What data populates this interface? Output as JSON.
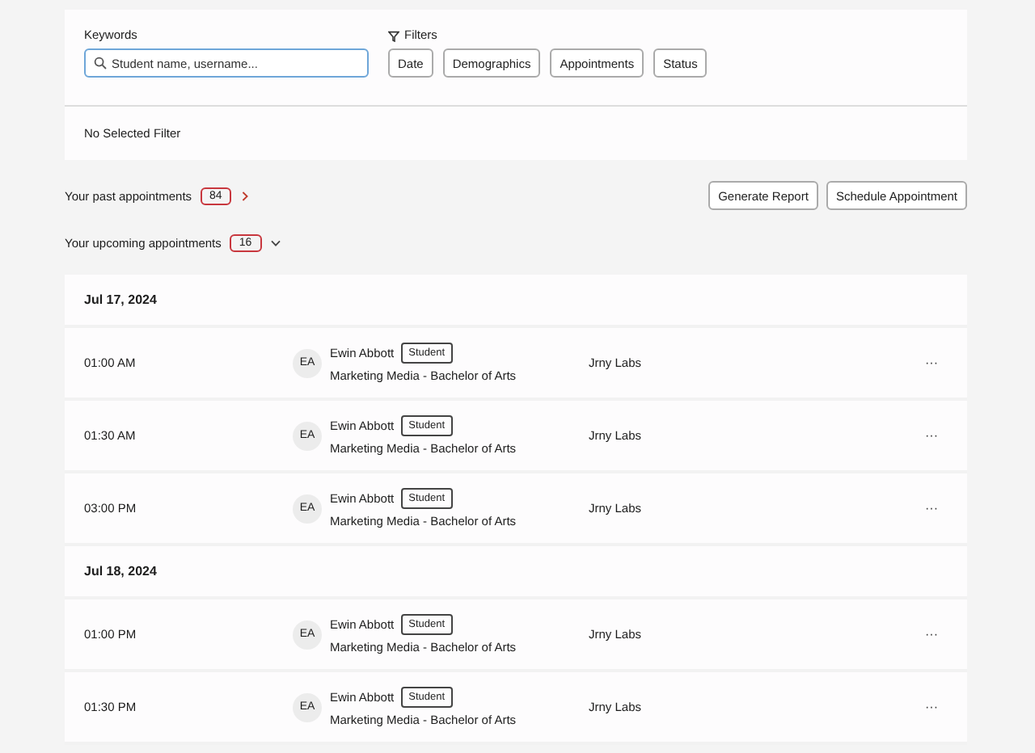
{
  "search": {
    "label": "Keywords",
    "placeholder": "Student name, username..."
  },
  "filters": {
    "label": "Filters",
    "buttons": [
      "Date",
      "Demographics",
      "Appointments",
      "Status"
    ],
    "selection": "No Selected Filter"
  },
  "past": {
    "label": "Your past appointments",
    "count": "84",
    "expanded": false
  },
  "actions": [
    "Generate Report",
    "Schedule Appointment"
  ],
  "upcoming": {
    "label": "Your upcoming appointments",
    "count": "16",
    "expanded": true
  },
  "days": [
    {
      "date": "Jul 17, 2024",
      "appointments": [
        {
          "time": "01:00 AM",
          "initials": "EA",
          "name": "Ewin Abbott",
          "role": "Student",
          "program": "Marketing Media - Bachelor of Arts",
          "location": "Jrny Labs",
          "more": "···"
        },
        {
          "time": "01:30 AM",
          "initials": "EA",
          "name": "Ewin Abbott",
          "role": "Student",
          "program": "Marketing Media - Bachelor of Arts",
          "location": "Jrny Labs",
          "more": "···"
        },
        {
          "time": "03:00 PM",
          "initials": "EA",
          "name": "Ewin Abbott",
          "role": "Student",
          "program": "Marketing Media - Bachelor of Arts",
          "location": "Jrny Labs",
          "more": "···"
        }
      ]
    },
    {
      "date": "Jul 18, 2024",
      "appointments": [
        {
          "time": "01:00 PM",
          "initials": "EA",
          "name": "Ewin Abbott",
          "role": "Student",
          "program": "Marketing Media - Bachelor of Arts",
          "location": "Jrny Labs",
          "more": "···"
        },
        {
          "time": "01:30 PM",
          "initials": "EA",
          "name": "Ewin Abbott",
          "role": "Student",
          "program": "Marketing Media - Bachelor of Arts",
          "location": "Jrny Labs",
          "more": "···"
        }
      ]
    }
  ]
}
